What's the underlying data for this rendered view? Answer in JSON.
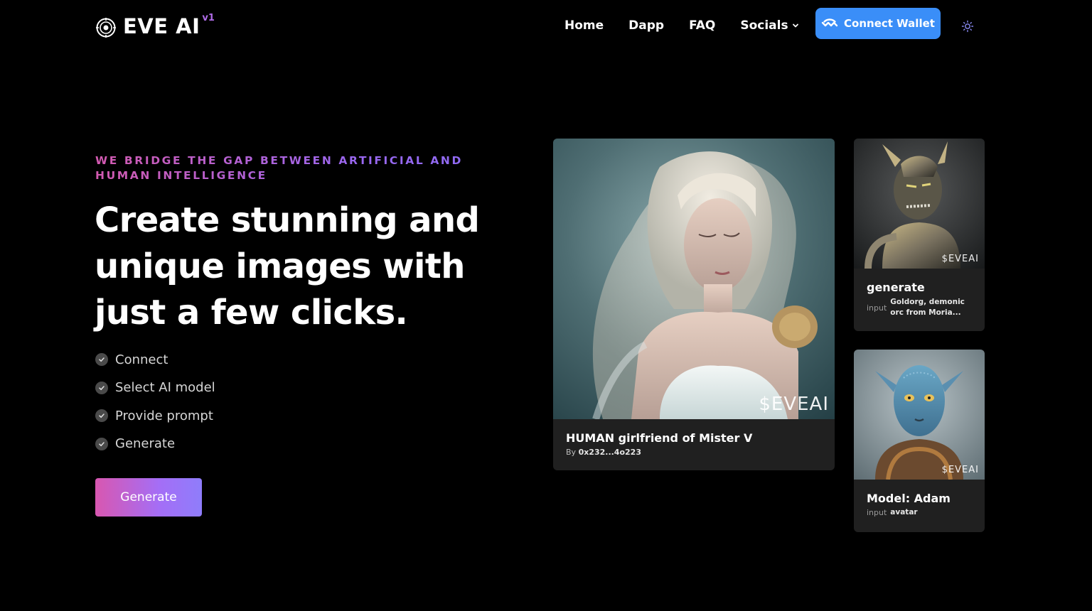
{
  "brand": {
    "name": "EVE AI",
    "version": "v1"
  },
  "nav": {
    "items": [
      "Home",
      "Dapp",
      "FAQ"
    ],
    "socials_label": "Socials",
    "connect_wallet_label": "Connect Wallet",
    "theme_icon": "sun-icon"
  },
  "hero": {
    "eyebrow": "WE BRIDGE THE GAP BETWEEN ARTIFICIAL AND HUMAN INTELLIGENCE",
    "title": "Create stunning and unique images with just a few clicks.",
    "steps": [
      "Connect",
      "Select AI model",
      "Provide prompt",
      "Generate"
    ],
    "cta_label": "Generate"
  },
  "cards": {
    "main": {
      "title": "HUMAN girlfriend of Mister V",
      "by_label": "By",
      "by_value": "0x232...4o223",
      "watermark": "$EVEAI"
    },
    "orc": {
      "title": "generate",
      "input_label": "input",
      "input_value": "Goldorg, demonic orc from Moria...",
      "watermark": "$EVEAI"
    },
    "avatar": {
      "title": "Model: Adam",
      "input_label": "input",
      "input_value": "avatar",
      "watermark": "$EVEAI"
    }
  },
  "colors": {
    "background": "#000000",
    "accent_blue": "#3a8ef8",
    "gradient_start": "#d857b0",
    "gradient_end": "#8f7dfb",
    "card_bg": "#202020"
  }
}
